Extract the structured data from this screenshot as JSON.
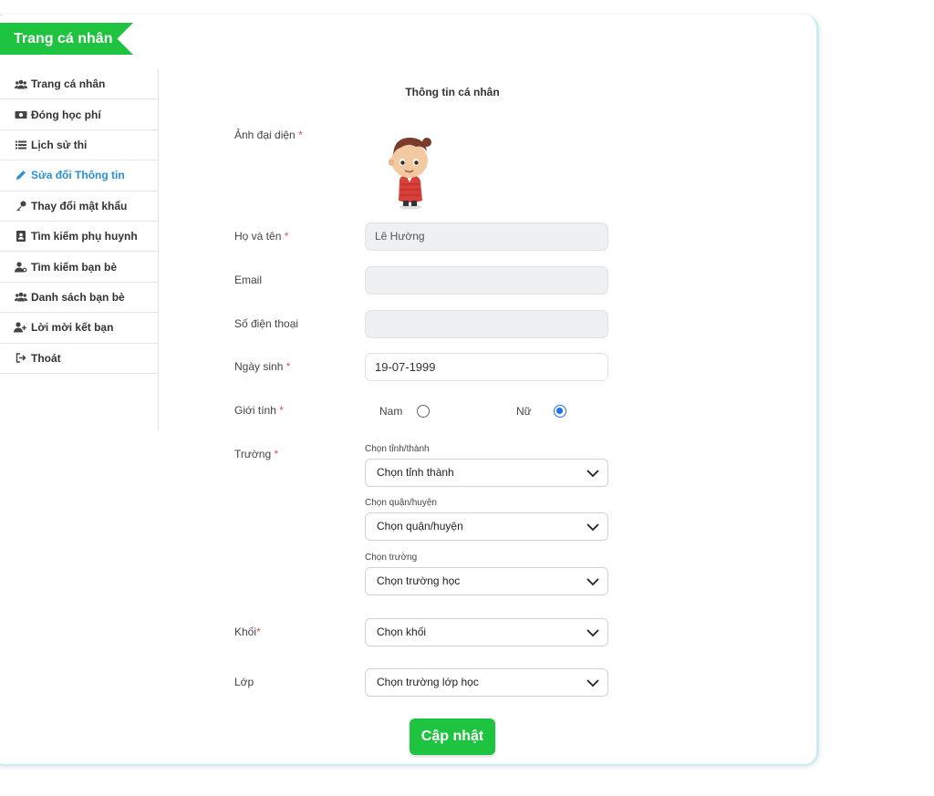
{
  "banner": {
    "title": "Trang cá nhân"
  },
  "sidebar": {
    "items": [
      {
        "label": "Trang cá nhân",
        "icon": "users-icon"
      },
      {
        "label": "Đóng học phí",
        "icon": "money-icon"
      },
      {
        "label": "Lịch sử thi",
        "icon": "list-icon"
      },
      {
        "label": "Sửa đổi Thông tin",
        "icon": "pencil-icon",
        "active": true
      },
      {
        "label": "Thay đổi mật khẩu",
        "icon": "key-icon"
      },
      {
        "label": "Tìm kiếm phụ huynh",
        "icon": "contact-card-icon"
      },
      {
        "label": "Tìm kiếm bạn bè",
        "icon": "user-search-icon"
      },
      {
        "label": "Danh sách bạn bè",
        "icon": "users-icon"
      },
      {
        "label": "Lời mời kết bạn",
        "icon": "user-plus-icon"
      },
      {
        "label": "Thoát",
        "icon": "sign-out-icon"
      }
    ]
  },
  "form": {
    "title": "Thông tin cá nhân",
    "avatar_label": "Ảnh đại diện",
    "name_label": "Họ và tên",
    "name_value": "Lê Hường",
    "email_label": "Email",
    "email_value": "",
    "phone_label": "Số điện thoại",
    "phone_value": "",
    "dob_label": "Ngày sinh",
    "dob_value": "19-07-1999",
    "gender_label": "Giới tính",
    "gender_male": "Nam",
    "gender_female": "Nữ",
    "gender_selected": "Nữ",
    "school_label": "Trường",
    "province_label": "Chọn tỉnh/thành",
    "province_value": "Chọn tỉnh thành",
    "district_label": "Chọn quận/huyện",
    "district_value": "Chọn quận/huyện",
    "school_sub_label": "Chọn trường",
    "school_value": "Chọn trường học",
    "grade_label": "Khối",
    "grade_value": "Chọn khối",
    "class_label": "Lớp",
    "class_value": "Chọn trường lớp học",
    "submit_label": "Cập nhật",
    "required_mark": "*"
  },
  "colors": {
    "accent": "#1ec33f",
    "active_link": "#2a8fd6",
    "required": "#d9534f",
    "radio": "#1a73e8"
  }
}
